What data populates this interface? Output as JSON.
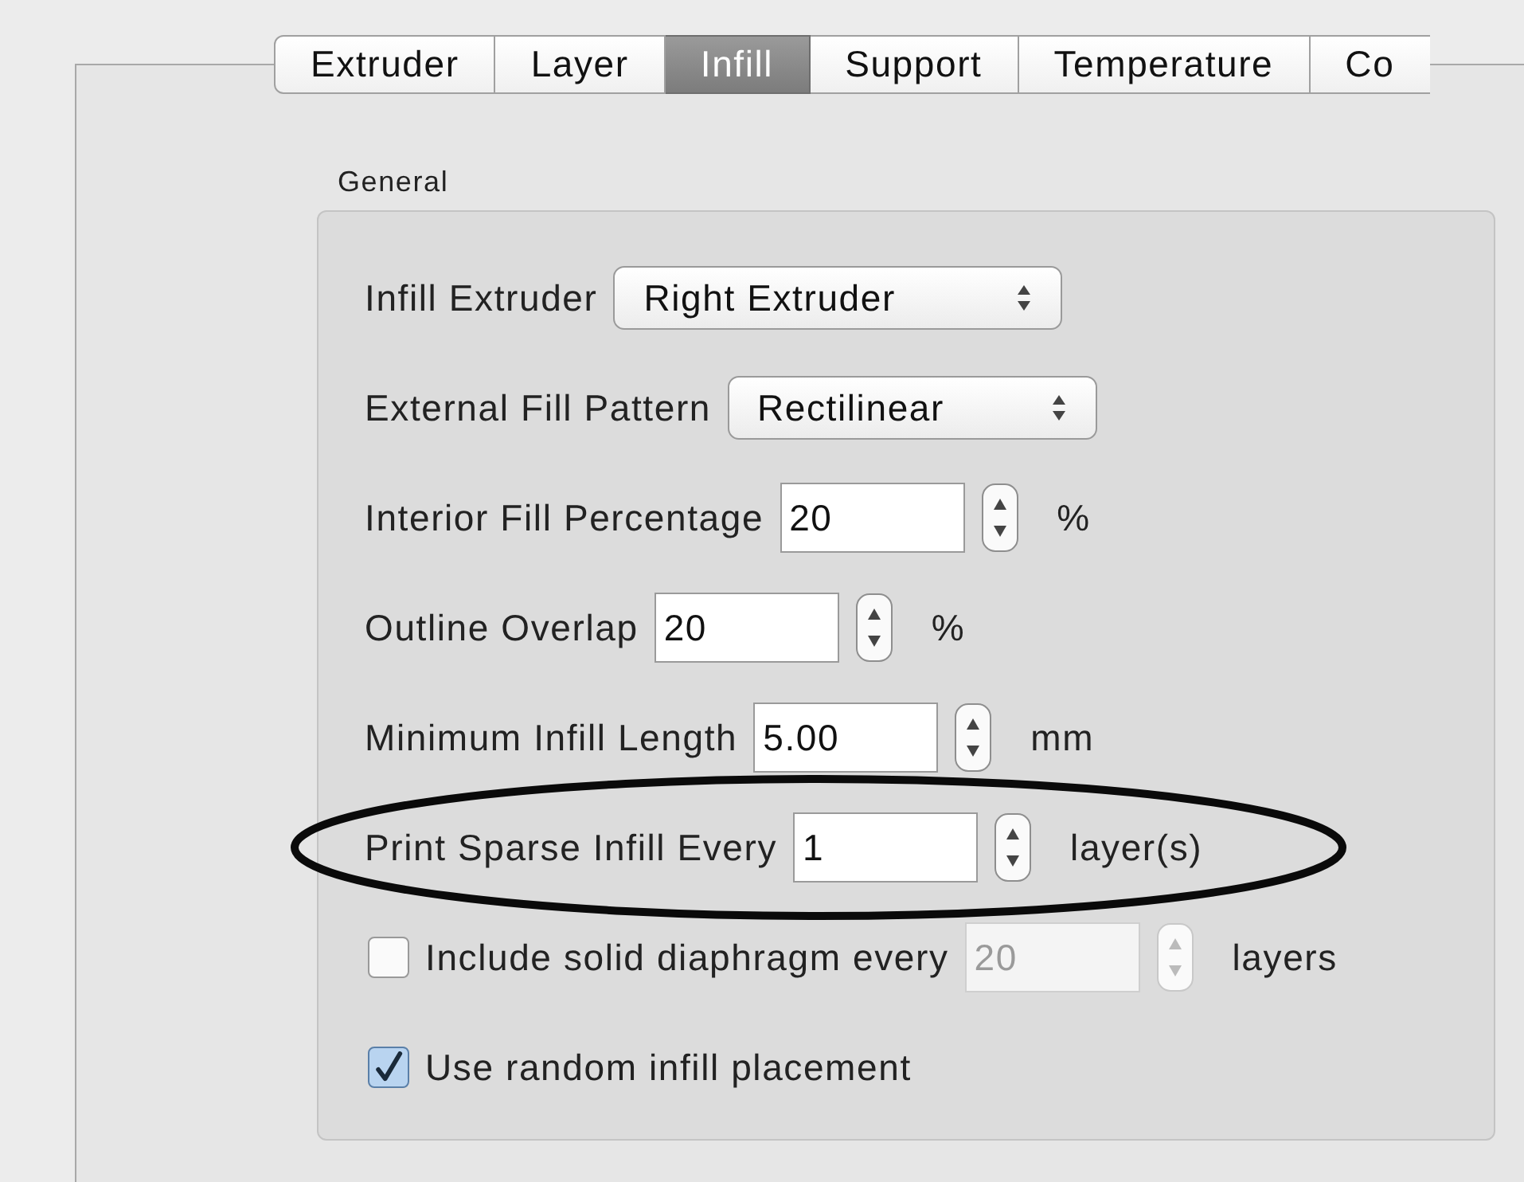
{
  "tabs": [
    {
      "label": "Extruder",
      "selected": false
    },
    {
      "label": "Layer",
      "selected": false
    },
    {
      "label": "Infill",
      "selected": true
    },
    {
      "label": "Support",
      "selected": false
    },
    {
      "label": "Temperature",
      "selected": false
    },
    {
      "label": "Co",
      "selected": false
    }
  ],
  "group": {
    "title": "General",
    "rows": [
      {
        "kind": "select",
        "label": "Infill Extruder",
        "value": "Right Extruder",
        "highlighted": false
      },
      {
        "kind": "select",
        "label": "External Fill Pattern",
        "value": "Rectilinear",
        "highlighted": false
      },
      {
        "kind": "spinner",
        "label": "Interior Fill Percentage",
        "value": "20",
        "unit": "%",
        "highlighted": false
      },
      {
        "kind": "spinner",
        "label": "Outline Overlap",
        "value": "20",
        "unit": "%",
        "highlighted": false
      },
      {
        "kind": "spinner",
        "label": "Minimum Infill Length",
        "value": "5.00",
        "unit": "mm",
        "highlighted": false
      },
      {
        "kind": "spinner",
        "label": "Print Sparse Infill Every",
        "value": "1",
        "unit": "layer(s)",
        "highlighted": true
      },
      {
        "kind": "checkbox-spinner",
        "label": "Include solid diaphragm every",
        "checked": false,
        "value": "20",
        "unit": "layers",
        "disabled": true,
        "highlighted": false
      },
      {
        "kind": "checkbox",
        "label": "Use random infill placement",
        "checked": true,
        "highlighted": false
      }
    ]
  }
}
